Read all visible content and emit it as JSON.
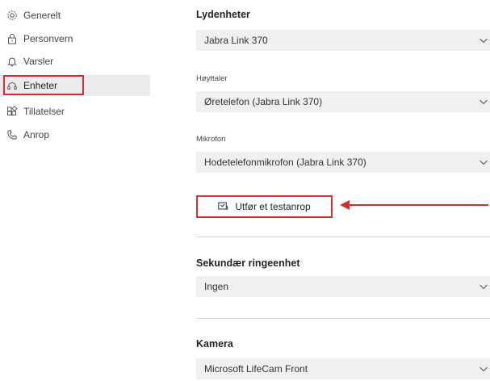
{
  "sidebar": {
    "items": [
      {
        "label": "Generelt",
        "icon": "gear-icon"
      },
      {
        "label": "Personvern",
        "icon": "lock-icon"
      },
      {
        "label": "Varsler",
        "icon": "bell-icon"
      },
      {
        "label": "Enheter",
        "icon": "devices-icon"
      },
      {
        "label": "Tillatelser",
        "icon": "apps-icon"
      },
      {
        "label": "Anrop",
        "icon": "phone-icon"
      }
    ],
    "active_index": 3
  },
  "devices": {
    "audio_heading": "Lydenheter",
    "audio_value": "Jabra Link 370",
    "speaker_label": "Høyttaler",
    "speaker_value": "Øretelefon (Jabra Link 370)",
    "mic_label": "Mikrofon",
    "mic_value": "Hodetelefonmikrofon (Jabra Link 370)",
    "test_call_label": "Utfør et testanrop",
    "secondary_heading": "Sekundær ringeenhet",
    "secondary_value": "Ingen",
    "camera_heading": "Kamera",
    "camera_value": "Microsoft LifeCam Front"
  },
  "colors": {
    "highlight": "#d32f2f",
    "dropdown_bg": "#f0f0f0",
    "active_bg": "#ebebeb"
  }
}
